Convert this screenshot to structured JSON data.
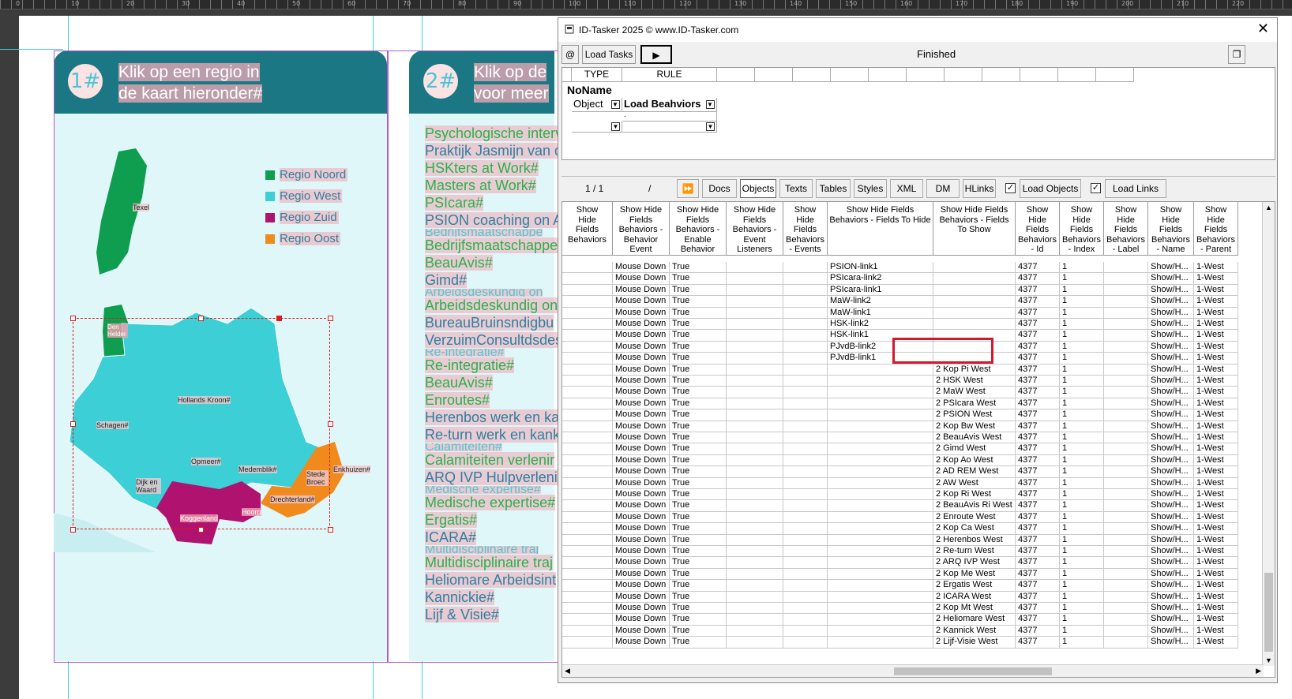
{
  "ruler": {
    "numbers": [
      "0",
      "10",
      "20",
      "30",
      "40",
      "50",
      "60",
      "70",
      "80",
      "90",
      "100",
      "110",
      "120",
      "130",
      "140",
      "150",
      "160",
      "170",
      "180",
      "190",
      "200",
      "210",
      "220"
    ]
  },
  "card1": {
    "number": "1#",
    "title_line1": "Klik op een regio in",
    "title_line2": "de kaart hieronder#",
    "legend": [
      {
        "label": "Regio Noord",
        "color": "#0f9e4f"
      },
      {
        "label": "Regio West",
        "color": "#3ccfd6"
      },
      {
        "label": "Regio Zuid",
        "color": "#b0126f"
      },
      {
        "label": "Regio Oost",
        "color": "#f08a1c"
      }
    ],
    "region_labels": {
      "texel": "Texel",
      "den_helder": "Den Helder",
      "hollands_kroon": "Hollands Kroon#",
      "schagen": "Schagen#",
      "opmeer": "Opmeer#",
      "medemblik": "Medemblik#",
      "enkhuizen": "Enkhuizen#",
      "stede_broec": "Stede Broec",
      "dijk_en_waard": "Dijk en Waard",
      "drechterland": "Drechterland#",
      "hoorn": "Hoorn",
      "koggenland": "Koggenland"
    }
  },
  "card2": {
    "number": "2#",
    "title_line1": "Klik op de",
    "title_line2": "voor meer",
    "items": [
      {
        "text": "Psychologische interv",
        "style": "g"
      },
      {
        "text": "Praktijk Jasmijn van d",
        "style": "b"
      },
      {
        "text": "HSKters at Work#",
        "style": "g"
      },
      {
        "text": "Masters at Work#",
        "style": "g"
      },
      {
        "text": "PSIcara#",
        "style": "g"
      },
      {
        "text": "PSION coaching on Ad",
        "style": "b"
      },
      {
        "text": "Bedrijfsmaatschappe",
        "style": "c"
      },
      {
        "text": "Bedrijfsmaatschappe",
        "style": "g"
      },
      {
        "text": "BeauAvis#",
        "style": "g"
      },
      {
        "text": "Gimd#",
        "style": "b"
      },
      {
        "text": "Arbeidsdeskundig on",
        "style": "c"
      },
      {
        "text": "Arbeidsdeskundig on",
        "style": "g"
      },
      {
        "text": "BureauBruinsndigbu",
        "style": "b"
      },
      {
        "text": "VerzuimConsultdsdes",
        "style": "b"
      },
      {
        "text": "Re-integratie#",
        "style": "c"
      },
      {
        "text": "Re-integratie#",
        "style": "g"
      },
      {
        "text": "BeauAvis#",
        "style": "g"
      },
      {
        "text": "Enroutes#",
        "style": "g"
      },
      {
        "text": "Herenbos werk en kank",
        "style": "b"
      },
      {
        "text": "Re-turn werk en kank",
        "style": "b"
      },
      {
        "text": "Calamiteiten#",
        "style": "c"
      },
      {
        "text": "Calamiteiten verlenir",
        "style": "g"
      },
      {
        "text": "ARQ IVP Hulpverlenin",
        "style": "b"
      },
      {
        "text": "Medische expertise#",
        "style": "c"
      },
      {
        "text": "Medische expertise#",
        "style": "g"
      },
      {
        "text": "Ergatis#",
        "style": "g"
      },
      {
        "text": "ICARA#",
        "style": "b"
      },
      {
        "text": "Multidisciplinaire traj",
        "style": "c"
      },
      {
        "text": "Multidisciplinaire traj",
        "style": "g"
      },
      {
        "text": "Heliomare Arbeidsint",
        "style": "b"
      },
      {
        "text": "Kannickie#",
        "style": "b"
      },
      {
        "text": "Lijf & Visie#",
        "style": "b"
      }
    ]
  },
  "window": {
    "title": "ID-Tasker 2025  © www.ID-Tasker.com",
    "at_button": "@",
    "load_tasks": "Load Tasks",
    "play_icon": "play-icon",
    "status": "Finished",
    "restore_icon": "restore-icon",
    "close_icon": "close-icon",
    "task_grid": {
      "headers": [
        "TYPE",
        "RULE"
      ],
      "group": "NoName",
      "row_type": "Object",
      "row_rule": "Load Beahviors",
      "row2_rule": "."
    },
    "tabs": {
      "pager": "1 / 1",
      "slash": "/",
      "buttons": [
        "Docs",
        "Objects",
        "Texts",
        "Tables",
        "Styles",
        "XML",
        "DM",
        "HLinks"
      ],
      "active": "Objects",
      "load_objects": "Load Objects",
      "load_links": "Load Links"
    },
    "columns": [
      "Show Hide Fields Behaviors",
      "Show Hide Fields Behaviors - Behavior Event",
      "Show Hide Fields Behaviors - Enable Behavior",
      "Show Hide Fields Behaviors - Event Listeners",
      "Show Hide Fields Behaviors - Events",
      "Show Hide Fields Behaviors - Fields To Hide",
      "Show Hide Fields Behaviors - Fields To Show",
      "Show Hide Fields Behaviors - Id",
      "Show Hide Fields Behaviors - Index",
      "Show Hide Fields Behaviors - Label",
      "Show Hide Fields Behaviors - Name",
      "Show Hide Fields Behaviors - Parent"
    ],
    "rows": [
      [
        "",
        "Mouse Down",
        "True",
        "",
        "",
        "PSION-link1",
        "",
        "4377",
        "1",
        "",
        "Show/H...",
        "1-West"
      ],
      [
        "",
        "Mouse Down",
        "True",
        "",
        "",
        "PSIcara-link2",
        "",
        "4377",
        "1",
        "",
        "Show/H...",
        "1-West"
      ],
      [
        "",
        "Mouse Down",
        "True",
        "",
        "",
        "PSIcara-link1",
        "",
        "4377",
        "1",
        "",
        "Show/H...",
        "1-West"
      ],
      [
        "",
        "Mouse Down",
        "True",
        "",
        "",
        "MaW-link2",
        "",
        "4377",
        "1",
        "",
        "Show/H...",
        "1-West"
      ],
      [
        "",
        "Mouse Down",
        "True",
        "",
        "",
        "MaW-link1",
        "",
        "4377",
        "1",
        "",
        "Show/H...",
        "1-West"
      ],
      [
        "",
        "Mouse Down",
        "True",
        "",
        "",
        "HSK-link2",
        "",
        "4377",
        "1",
        "",
        "Show/H...",
        "1-West"
      ],
      [
        "",
        "Mouse Down",
        "True",
        "",
        "",
        "HSK-link1",
        "",
        "4377",
        "1",
        "",
        "Show/H...",
        "1-West"
      ],
      [
        "",
        "Mouse Down",
        "True",
        "",
        "",
        "PJvdB-link2",
        "",
        "4377",
        "1",
        "",
        "Show/H...",
        "1-West"
      ],
      [
        "",
        "Mouse Down",
        "True",
        "",
        "",
        "PJvdB-link1",
        "",
        "4377",
        "1",
        "",
        "Show/H...",
        "1-West"
      ],
      [
        "",
        "Mouse Down",
        "True",
        "",
        "",
        "",
        "2 Kop Pi West",
        "4377",
        "1",
        "",
        "Show/H...",
        "1-West"
      ],
      [
        "",
        "Mouse Down",
        "True",
        "",
        "",
        "",
        "2 HSK West",
        "4377",
        "1",
        "",
        "Show/H...",
        "1-West"
      ],
      [
        "",
        "Mouse Down",
        "True",
        "",
        "",
        "",
        "2 MaW West",
        "4377",
        "1",
        "",
        "Show/H...",
        "1-West"
      ],
      [
        "",
        "Mouse Down",
        "True",
        "",
        "",
        "",
        "2 PSIcara West",
        "4377",
        "1",
        "",
        "Show/H...",
        "1-West"
      ],
      [
        "",
        "Mouse Down",
        "True",
        "",
        "",
        "",
        "2 PSION West",
        "4377",
        "1",
        "",
        "Show/H...",
        "1-West"
      ],
      [
        "",
        "Mouse Down",
        "True",
        "",
        "",
        "",
        "2 Kop Bw West",
        "4377",
        "1",
        "",
        "Show/H...",
        "1-West"
      ],
      [
        "",
        "Mouse Down",
        "True",
        "",
        "",
        "",
        "2 BeauAvis West",
        "4377",
        "1",
        "",
        "Show/H...",
        "1-West"
      ],
      [
        "",
        "Mouse Down",
        "True",
        "",
        "",
        "",
        "2 Gimd West",
        "4377",
        "1",
        "",
        "Show/H...",
        "1-West"
      ],
      [
        "",
        "Mouse Down",
        "True",
        "",
        "",
        "",
        "2 Kop Ao West",
        "4377",
        "1",
        "",
        "Show/H...",
        "1-West"
      ],
      [
        "",
        "Mouse Down",
        "True",
        "",
        "",
        "",
        "2 AD REM West",
        "4377",
        "1",
        "",
        "Show/H...",
        "1-West"
      ],
      [
        "",
        "Mouse Down",
        "True",
        "",
        "",
        "",
        "2 AW West",
        "4377",
        "1",
        "",
        "Show/H...",
        "1-West"
      ],
      [
        "",
        "Mouse Down",
        "True",
        "",
        "",
        "",
        "2 Kop Ri West",
        "4377",
        "1",
        "",
        "Show/H...",
        "1-West"
      ],
      [
        "",
        "Mouse Down",
        "True",
        "",
        "",
        "",
        "2 BeauAvis Ri West",
        "4377",
        "1",
        "",
        "Show/H...",
        "1-West"
      ],
      [
        "",
        "Mouse Down",
        "True",
        "",
        "",
        "",
        "2 Enroute West",
        "4377",
        "1",
        "",
        "Show/H...",
        "1-West"
      ],
      [
        "",
        "Mouse Down",
        "True",
        "",
        "",
        "",
        "2 Kop Ca West",
        "4377",
        "1",
        "",
        "Show/H...",
        "1-West"
      ],
      [
        "",
        "Mouse Down",
        "True",
        "",
        "",
        "",
        "2 Herenbos West",
        "4377",
        "1",
        "",
        "Show/H...",
        "1-West"
      ],
      [
        "",
        "Mouse Down",
        "True",
        "",
        "",
        "",
        "2 Re-turn West",
        "4377",
        "1",
        "",
        "Show/H...",
        "1-West"
      ],
      [
        "",
        "Mouse Down",
        "True",
        "",
        "",
        "",
        "2 ARQ IVP West",
        "4377",
        "1",
        "",
        "Show/H...",
        "1-West"
      ],
      [
        "",
        "Mouse Down",
        "True",
        "",
        "",
        "",
        "2 Kop Me West",
        "4377",
        "1",
        "",
        "Show/H...",
        "1-West"
      ],
      [
        "",
        "Mouse Down",
        "True",
        "",
        "",
        "",
        "2 Ergatis West",
        "4377",
        "1",
        "",
        "Show/H...",
        "1-West"
      ],
      [
        "",
        "Mouse Down",
        "True",
        "",
        "",
        "",
        "2 ICARA West",
        "4377",
        "1",
        "",
        "Show/H...",
        "1-West"
      ],
      [
        "",
        "Mouse Down",
        "True",
        "",
        "",
        "",
        "2 Kop Mt West",
        "4377",
        "1",
        "",
        "Show/H...",
        "1-West"
      ],
      [
        "",
        "Mouse Down",
        "True",
        "",
        "",
        "",
        "2 Heliomare West",
        "4377",
        "1",
        "",
        "Show/H...",
        "1-West"
      ],
      [
        "",
        "Mouse Down",
        "True",
        "",
        "",
        "",
        "2 Kannick West",
        "4377",
        "1",
        "",
        "Show/H...",
        "1-West"
      ],
      [
        "",
        "Mouse Down",
        "True",
        "",
        "",
        "",
        "2 Lijf-Visie West",
        "4377",
        "1",
        "",
        "Show/H...",
        "1-West"
      ]
    ]
  }
}
